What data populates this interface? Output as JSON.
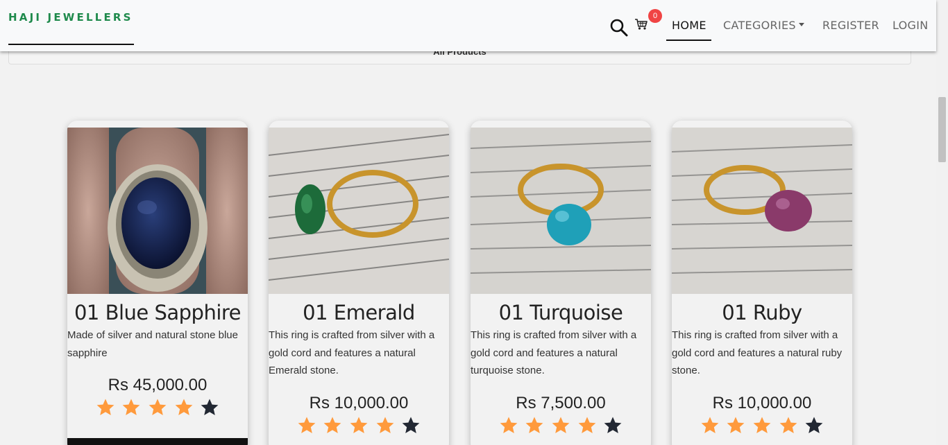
{
  "nav": {
    "brand": "HAJI JEWELLERS",
    "cart_count": "0",
    "links": {
      "home": "HOME",
      "categories": "CATEGORIES",
      "register": "REGISTER",
      "login": "LOGIN"
    }
  },
  "section_title": "All Products",
  "colors": {
    "brand": "#1f8a4c",
    "star_filled": "#ff9a3c",
    "star_empty": "#222833",
    "badge": "#f04444"
  },
  "products": [
    {
      "name": "01 Blue Sapphire",
      "description": "Made of silver and natural stone blue sapphire",
      "price": "Rs 45,000.00",
      "rating": 4,
      "rating_max": 5
    },
    {
      "name": "01 Emerald",
      "description": "This ring is crafted from silver with a gold cord and features a natural Emerald stone.",
      "price": "Rs 10,000.00",
      "rating": 4,
      "rating_max": 5
    },
    {
      "name": "01 Turquoise",
      "description": "This ring is crafted from silver with a gold cord and features a natural turquoise stone.",
      "price": "Rs 7,500.00",
      "rating": 4,
      "rating_max": 5
    },
    {
      "name": "01 Ruby",
      "description": "This ring is crafted from silver with a gold cord and features a natural ruby stone.",
      "price": "Rs 10,000.00",
      "rating": 4,
      "rating_max": 5
    }
  ]
}
